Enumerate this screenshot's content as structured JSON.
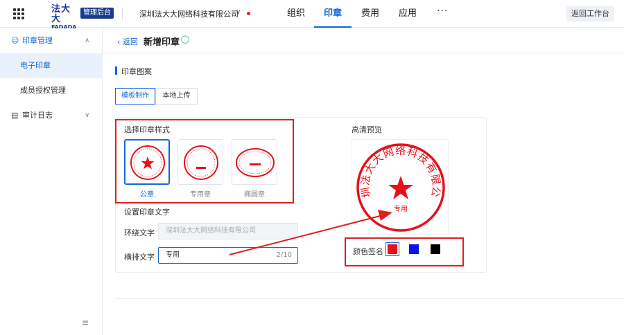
{
  "header": {
    "logo_text": "法大大",
    "logo_sub": "FADADA",
    "admin_badge": "管理后台",
    "company": "深圳法大大网络科技有限公司",
    "nav": [
      {
        "label": "组织",
        "active": false
      },
      {
        "label": "印章",
        "active": true
      },
      {
        "label": "费用",
        "active": false
      },
      {
        "label": "应用",
        "active": false
      }
    ],
    "more": "···",
    "back_workspace": "返回工作台"
  },
  "sidebar": {
    "groups": [
      {
        "label": "印章管理",
        "icon": "user-icon",
        "expanded": true
      },
      {
        "label": "审计日志",
        "icon": "log-icon",
        "expanded": false
      }
    ],
    "items": [
      {
        "label": "电子印章",
        "active": true
      },
      {
        "label": "成员授权管理",
        "active": false
      }
    ],
    "collapse_icon": "collapse-icon"
  },
  "page": {
    "back": "返回",
    "title": "新增印章",
    "section_title": "印章图案",
    "tabs": [
      {
        "label": "模板制作",
        "active": true
      },
      {
        "label": "本地上传",
        "active": false
      }
    ],
    "style_heading": "选择印章样式",
    "styles": [
      {
        "label": "公章",
        "active": true
      },
      {
        "label": "专用章",
        "active": false
      },
      {
        "label": "椭圆章",
        "active": false
      }
    ],
    "text_heading": "设置印章文字",
    "ring_label": "环绕文字",
    "ring_value": "深圳法大大网络科技有限公司",
    "horizontal_label": "横排文字",
    "horizontal_value": "专用",
    "horizontal_counter": "2/10",
    "preview_heading": "高清预览",
    "color_label": "颜色签名",
    "colors": [
      "#e8101a",
      "#0a14e6",
      "#000000"
    ],
    "selected_color": "#e8101a",
    "preview_ring_text": "深圳法大大网络科技有限公司",
    "preview_center_text": "专用"
  },
  "colors": {
    "accent": "#1468d6",
    "annotation": "#e01e1e",
    "seal": "#e8101a"
  }
}
